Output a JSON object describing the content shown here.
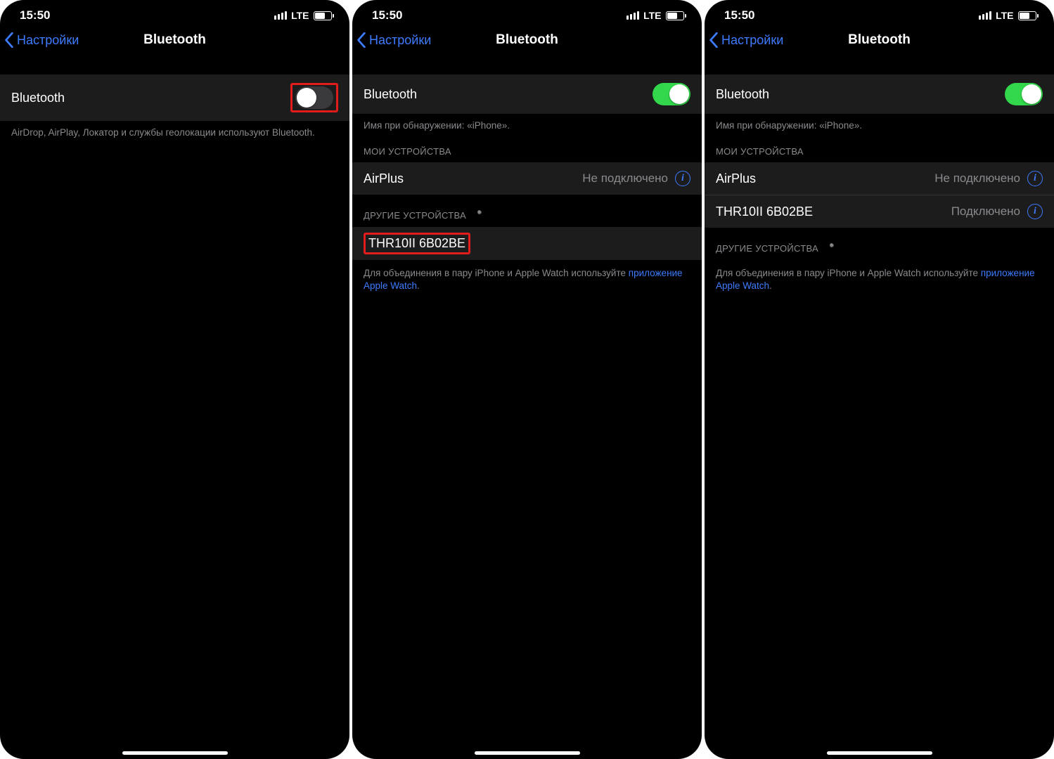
{
  "status": {
    "time": "15:50",
    "net": "LTE"
  },
  "nav": {
    "back": "Настройки",
    "title": "Bluetooth"
  },
  "bt_label": "Bluetooth",
  "screen1": {
    "note": "AirDrop, AirPlay, Локатор и службы геолокации используют Bluetooth."
  },
  "screen2": {
    "discover": "Имя при обнаружении: «iPhone».",
    "my_head": "МОИ УСТРОЙСТВА",
    "dev1": {
      "name": "AirPlus",
      "status": "Не подключено"
    },
    "other_head": "ДРУГИЕ УСТРОЙСТВА",
    "other1": {
      "name": "THR10II 6B02BE"
    },
    "foot_pre": "Для объединения в пару iPhone и Apple Watch используйте ",
    "foot_link": "приложение Apple Watch",
    "foot_post": "."
  },
  "screen3": {
    "discover": "Имя при обнаружении: «iPhone».",
    "my_head": "МОИ УСТРОЙСТВА",
    "dev1": {
      "name": "AirPlus",
      "status": "Не подключено"
    },
    "dev2": {
      "name": "THR10II 6B02BE",
      "status": "Подключено"
    },
    "other_head": "ДРУГИЕ УСТРОЙСТВА",
    "foot_pre": "Для объединения в пару iPhone и Apple Watch используйте ",
    "foot_link": "приложение Apple Watch",
    "foot_post": "."
  }
}
